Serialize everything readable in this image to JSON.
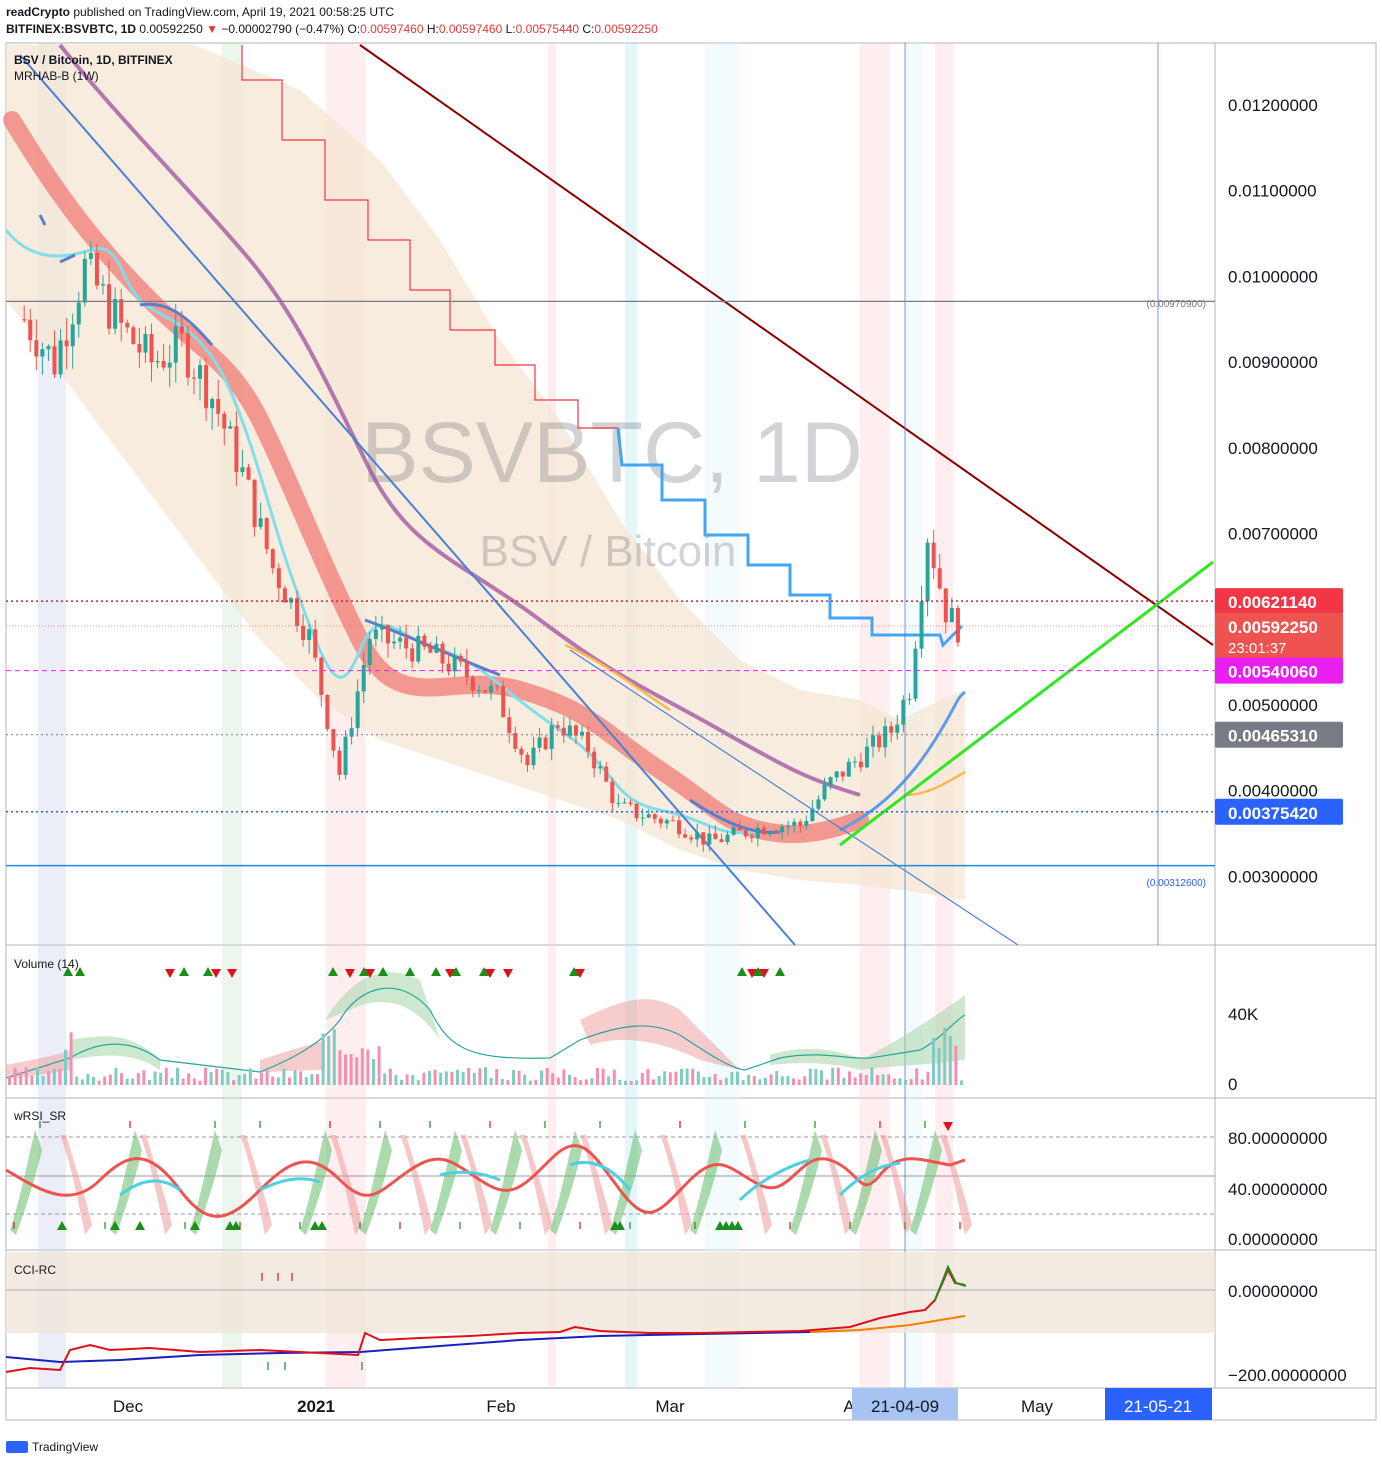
{
  "header": {
    "author": "readCrypto",
    "published_text": "published on TradingView.com, April 19, 2021 00:58:25 UTC",
    "symbol_line": "BITFINEX:BSVBTC, 1D",
    "last_price": "0.00592250",
    "change_arrow": "▼",
    "change": "−0.00002790 (−0.47%)",
    "open_label": "O:",
    "open": "0.00597460",
    "high_label": "H:",
    "high": "0.00597460",
    "low_label": "L:",
    "low": "0.00575440",
    "close_label": "C:",
    "close": "0.00592250"
  },
  "chart": {
    "legend_title": "BSV / Bitcoin, 1D, BITFINEX",
    "legend_indicator": "MRHAB-B (1W)",
    "watermark_main": "BSVBTC, 1D",
    "watermark_sub": "BSV / Bitcoin",
    "level_labels": {
      "resistance_note": "(0.00970900)",
      "support_note": "(0.00312600)"
    },
    "price_tags": [
      {
        "value": "0.00621140",
        "color": "#f23645"
      },
      {
        "value": "0.00592250",
        "sub": "23:01:37",
        "color": "#ef5350"
      },
      {
        "value": "0.00540060",
        "color": "#e91ef0"
      },
      {
        "value": "0.00465310",
        "color": "#787b86"
      },
      {
        "value": "0.00375420",
        "color": "#2962ff"
      }
    ],
    "x_labels": [
      "Dec",
      "2021",
      "Feb",
      "Mar",
      "A",
      "May"
    ],
    "x_highlight_labels": [
      "21-04-09",
      "21-05-21"
    ]
  },
  "panels": {
    "volume": {
      "title": "Volume (14)",
      "ticks": [
        "40K",
        "0"
      ]
    },
    "wrsi": {
      "title": "wRSI_SR",
      "ticks": [
        "80.00000000",
        "40.00000000",
        "0.00000000"
      ]
    },
    "cci": {
      "title": "CCI-RC",
      "ticks": [
        "0.00000000",
        "−200.00000000"
      ]
    }
  },
  "footer": {
    "brand": "TradingView"
  },
  "chart_data": {
    "type": "line",
    "title": "BSV / Bitcoin, 1D, BITFINEX",
    "x": [
      "2020-11-15",
      "2020-11-20",
      "2020-11-25",
      "2020-12-01",
      "2020-12-06",
      "2020-12-11",
      "2020-12-16",
      "2020-12-21",
      "2020-12-26",
      "2021-01-01",
      "2021-01-06",
      "2021-01-11",
      "2021-01-16",
      "2021-01-21",
      "2021-01-26",
      "2021-02-01",
      "2021-02-06",
      "2021-02-11",
      "2021-02-16",
      "2021-02-21",
      "2021-02-26",
      "2021-03-03",
      "2021-03-08",
      "2021-03-13",
      "2021-03-18",
      "2021-03-23",
      "2021-03-28",
      "2021-04-02",
      "2021-04-07",
      "2021-04-10",
      "2021-04-13",
      "2021-04-16",
      "2021-04-18"
    ],
    "series": [
      {
        "values": [
          0.0095,
          0.009,
          0.0101,
          0.0094,
          0.009,
          0.0092,
          0.0086,
          0.0077,
          0.0066,
          0.0058,
          0.0042,
          0.0058,
          0.0057,
          0.0056,
          0.0054,
          0.0051,
          0.0043,
          0.0048,
          0.0045,
          0.0038,
          0.0037,
          0.0036,
          0.0034,
          0.0035,
          0.0036,
          0.0036,
          0.0041,
          0.0044,
          0.0047,
          0.0052,
          0.007,
          0.0061,
          0.0059
        ]
      }
    ],
    "ylim": [
      0.0022,
      0.0127
    ],
    "y_ticks": [
      "0.01200000",
      "0.01100000",
      "0.01000000",
      "0.00900000",
      "0.00800000",
      "0.00700000",
      "0.00500000",
      "0.00400000",
      "0.00300000"
    ],
    "horizontal_levels": [
      0.009709,
      0.0062114,
      0.0054006,
      0.0046531,
      0.0037542,
      0.003126
    ],
    "grid": false,
    "legend": "top-left"
  }
}
